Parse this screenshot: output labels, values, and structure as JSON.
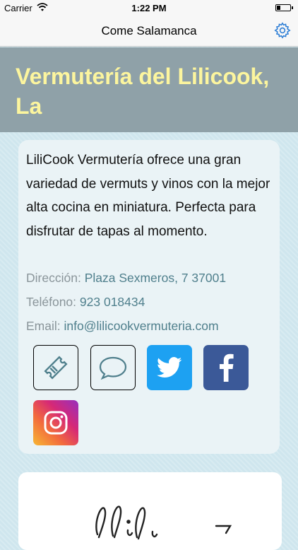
{
  "status_bar": {
    "carrier": "Carrier",
    "time": "1:22 PM"
  },
  "nav": {
    "title": "Come Salamanca",
    "settings_icon": "gear-icon"
  },
  "venue": {
    "name": "Vermutería del Lilicook, La",
    "description": "LiliCook Vermutería ofrece una gran variedad de vermuts y vinos con la mejor alta cocina en miniatura. Perfecta para disfrutar de tapas al momento.",
    "address_label": "Dirección:",
    "address": "Plaza Sexmeros, 7 37001",
    "phone_label": "Teléfono:",
    "phone": "923 018434",
    "email_label": "Email:",
    "email": "info@lilicookvermuteria.com"
  },
  "actions": [
    {
      "icon": "ticket-icon"
    },
    {
      "icon": "comment-icon"
    },
    {
      "icon": "twitter-icon"
    },
    {
      "icon": "facebook-icon"
    },
    {
      "icon": "instagram-icon"
    }
  ],
  "colors": {
    "title_band": "#8fa1a8",
    "title_text": "#fcf59e",
    "link": "#4f7f8c",
    "twitter": "#1da1f2",
    "facebook": "#3b5998",
    "nav_accent": "#2f7fd6"
  }
}
